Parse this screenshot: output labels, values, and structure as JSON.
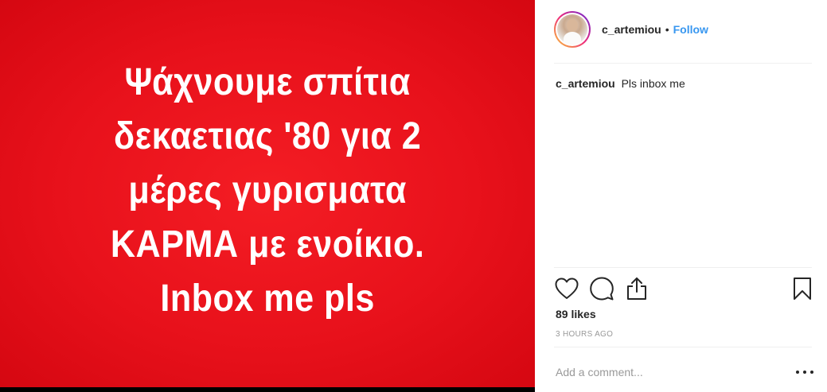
{
  "media": {
    "lines": [
      "Ψάχνουμε σπίτια",
      "δεκαετιας '80 για 2",
      "μέρες γυρισματα",
      "ΚΑΡΜΑ με ενοίκιο.",
      "Inbox me pls"
    ],
    "background_color": "#e8111b",
    "text_color": "#ffffff"
  },
  "header": {
    "username": "c_artemiou",
    "separator": "•",
    "follow_label": "Follow",
    "follow_color": "#3897f0"
  },
  "caption": {
    "username": "c_artemiou",
    "text": "Pls inbox me"
  },
  "actions": {
    "icons": [
      "heart-icon",
      "comment-icon",
      "share-icon",
      "bookmark-icon"
    ]
  },
  "likes": "89 likes",
  "timestamp": "3 HOURS AGO",
  "comment": {
    "placeholder": "Add a comment...",
    "more_icon": "more-options-icon"
  }
}
